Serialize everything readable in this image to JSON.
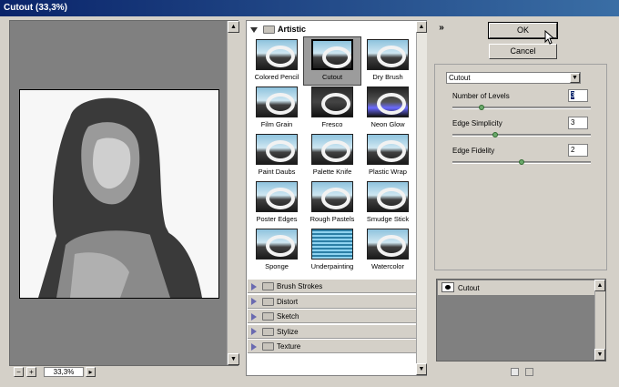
{
  "window": {
    "title": "Cutout (33,3%)"
  },
  "preview": {
    "zoom_level": "33,3%",
    "zoom_out": "−",
    "zoom_in": "+",
    "zoom_menu": "▸"
  },
  "gallery": {
    "category_open": "Artistic",
    "filters": [
      {
        "label": "Colored Pencil",
        "style": "light"
      },
      {
        "label": "Cutout",
        "style": "light",
        "selected": true
      },
      {
        "label": "Dry Brush",
        "style": "light"
      },
      {
        "label": "Film Grain",
        "style": "light"
      },
      {
        "label": "Fresco",
        "style": "dark"
      },
      {
        "label": "Neon Glow",
        "style": "neon"
      },
      {
        "label": "Paint Daubs",
        "style": "light"
      },
      {
        "label": "Palette Knife",
        "style": "light"
      },
      {
        "label": "Plastic Wrap",
        "style": "light"
      },
      {
        "label": "Poster Edges",
        "style": "light"
      },
      {
        "label": "Rough Pastels",
        "style": "light"
      },
      {
        "label": "Smudge Stick",
        "style": "light"
      },
      {
        "label": "Sponge",
        "style": "light"
      },
      {
        "label": "Underpainting",
        "style": "water"
      },
      {
        "label": "Watercolor",
        "style": "light"
      }
    ],
    "categories_collapsed": [
      "Brush Strokes",
      "Distort",
      "Sketch",
      "Stylize",
      "Texture"
    ]
  },
  "buttons": {
    "ok": "OK",
    "cancel": "Cancel",
    "collapse": "»"
  },
  "settings": {
    "filter_select": "Cutout",
    "params": [
      {
        "label": "Number of Levels",
        "value": "3",
        "slider_fraction": 0.2,
        "focused": true
      },
      {
        "label": "Edge Simplicity",
        "value": "3",
        "slider_fraction": 0.3
      },
      {
        "label": "Edge Fidelity",
        "value": "2",
        "slider_fraction": 0.5
      }
    ]
  },
  "layers": {
    "items": [
      {
        "label": "Cutout"
      }
    ]
  },
  "colors": {
    "accent": "#0a246a",
    "chrome": "#d4d0c8",
    "preview_bg": "#808080"
  }
}
